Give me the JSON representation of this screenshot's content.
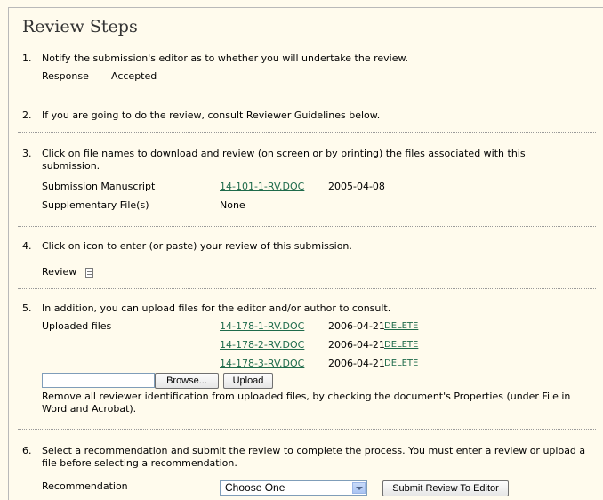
{
  "title": "Review Steps",
  "steps": [
    {
      "num": "1.",
      "text": "Notify the submission's editor as to whether you will undertake the review.",
      "response_label": "Response",
      "response_value": "Accepted"
    },
    {
      "num": "2.",
      "text": "If you are going to do the review, consult Reviewer Guidelines below."
    },
    {
      "num": "3.",
      "text": "Click on file names to download and review (on screen or by printing) the files associated with this submission.",
      "manuscript_label": "Submission Manuscript",
      "manuscript_file": "14-101-1-RV.DOC",
      "manuscript_date": "2005-04-08",
      "supp_label": "Supplementary File(s)",
      "supp_value": "None"
    },
    {
      "num": "4.",
      "text": "Click on icon to enter (or paste) your review of this submission.",
      "review_label": "Review",
      "review_icon": "document-icon"
    },
    {
      "num": "5.",
      "text": "In addition, you can upload files for the editor and/or author to consult.",
      "uploaded_label": "Uploaded files",
      "files": [
        {
          "name": "14-178-1-RV.DOC",
          "date": "2006-04-21",
          "delete": "DELETE"
        },
        {
          "name": "14-178-2-RV.DOC",
          "date": "2006-04-21",
          "delete": "DELETE"
        },
        {
          "name": "14-178-3-RV.DOC",
          "date": "2006-04-21",
          "delete": "DELETE"
        }
      ],
      "file_input_value": "",
      "browse_label": "Browse...",
      "upload_label": "Upload",
      "note": "Remove all reviewer identification from uploaded files, by checking the document's Properties (under File in Word and Acrobat)."
    },
    {
      "num": "6.",
      "text": "Select a recommendation and submit the review to complete the process. You must enter a review or upload a file before selecting a recommendation.",
      "recommendation_label": "Recommendation",
      "recommendation_selected": "Choose One",
      "submit_label": "Submit Review To Editor"
    }
  ],
  "colors": {
    "background": "#fffbed",
    "link": "#1f6b4b",
    "title": "#333333"
  }
}
